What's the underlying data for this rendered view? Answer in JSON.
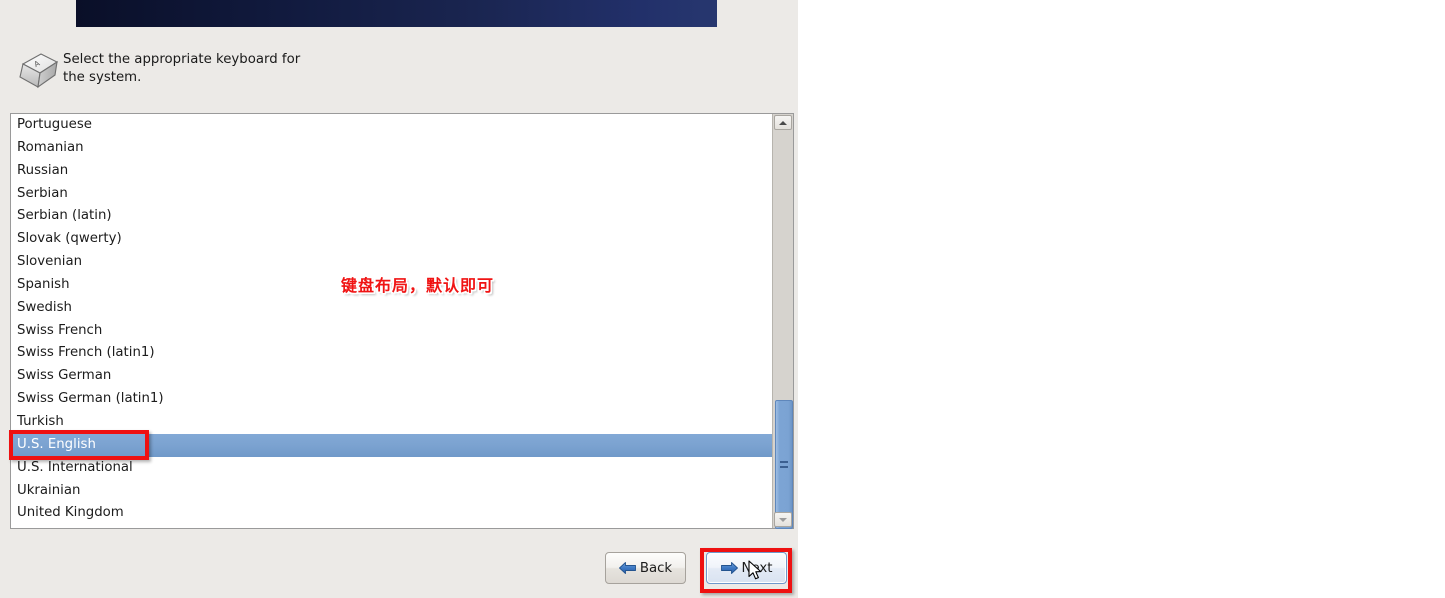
{
  "window": {
    "background_color": "#eceae7",
    "banner_color_start": "#0a0f28",
    "banner_color_end": "#27376f"
  },
  "header": {
    "icon": "keyboard-key-icon",
    "instruction": "Select the appropriate keyboard for\nthe system."
  },
  "keyboard_list": {
    "selected_index": 14,
    "items": [
      "Portuguese",
      "Romanian",
      "Russian",
      "Serbian",
      "Serbian (latin)",
      "Slovak (qwerty)",
      "Slovenian",
      "Spanish",
      "Swedish",
      "Swiss French",
      "Swiss French (latin1)",
      "Swiss German",
      "Swiss German (latin1)",
      "Turkish",
      "U.S. English",
      "U.S. International",
      "Ukrainian",
      "United Kingdom"
    ],
    "selection_color": "#7ba3d3",
    "scrollbar": {
      "up_icon": "chevron-up-icon",
      "down_icon": "chevron-down-icon",
      "thumb_color": "#7ba3d3"
    }
  },
  "footer": {
    "back_label": "Back",
    "back_icon": "arrow-left-icon",
    "next_label": "Next",
    "next_icon": "arrow-right-icon"
  },
  "annotations": {
    "note_text": "键盘布局，默认即可",
    "note_color": "#f01414",
    "box_color": "#ee1111"
  }
}
